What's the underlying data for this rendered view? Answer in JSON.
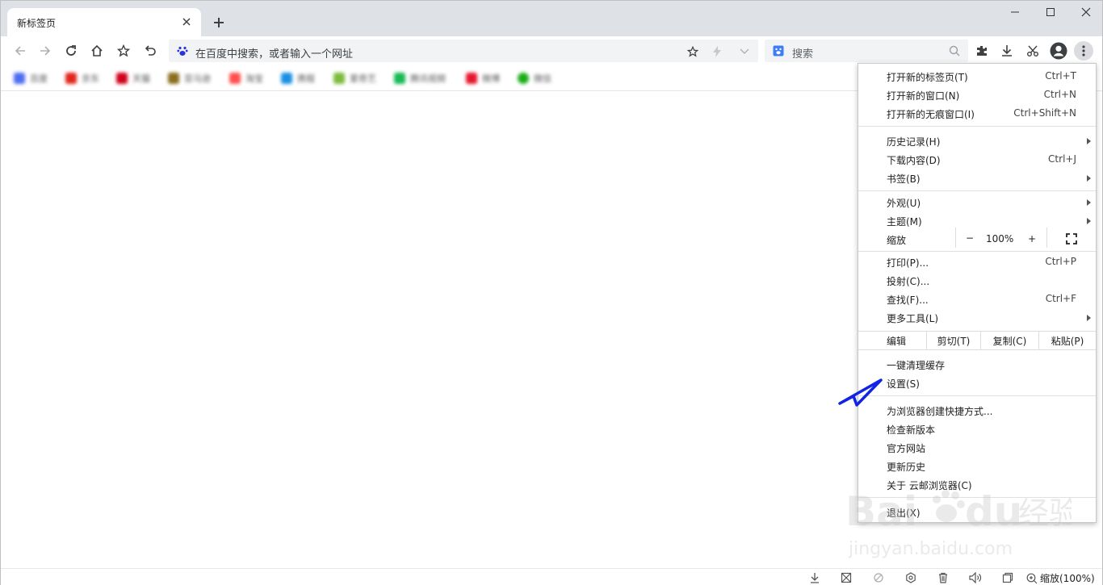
{
  "tab": {
    "title": "新标签页"
  },
  "omnibox": {
    "placeholder": "在百度中搜索，或者输入一个网址"
  },
  "search": {
    "placeholder": "搜索"
  },
  "bookmarks": [
    {
      "label": "百度",
      "color": "#4e6ef2"
    },
    {
      "label": "京东",
      "color": "#e1251b"
    },
    {
      "label": "天猫",
      "color": "#d0021b"
    },
    {
      "label": "亚马逊",
      "color": "#8a6d1e"
    },
    {
      "label": "淘宝",
      "color": "#ff4f4f"
    },
    {
      "label": "携程",
      "color": "#1a8fe3"
    },
    {
      "label": "爱奇艺",
      "color": "#7dbb3c"
    },
    {
      "label": "腾讯视频",
      "color": "#19b955"
    },
    {
      "label": "微博",
      "color": "#e6162d"
    },
    {
      "label": "微信",
      "color": "#1aad19"
    }
  ],
  "menu": {
    "group1": [
      {
        "label": "打开新的标签页(T)",
        "shortcut": "Ctrl+T"
      },
      {
        "label": "打开新的窗口(N)",
        "shortcut": "Ctrl+N"
      },
      {
        "label": "打开新的无痕窗口(I)",
        "shortcut": "Ctrl+Shift+N"
      }
    ],
    "group2": [
      {
        "label": "历史记录(H)",
        "shortcut": ""
      },
      {
        "label": "下载内容(D)",
        "shortcut": "Ctrl+J"
      },
      {
        "label": "书签(B)",
        "shortcut": ""
      }
    ],
    "group3": [
      {
        "label": "外观(U)"
      },
      {
        "label": "主题(M)"
      }
    ],
    "zoom": {
      "label": "缩放",
      "minus": "−",
      "value": "100%",
      "plus": "+"
    },
    "group4": [
      {
        "label": "打印(P)...",
        "shortcut": "Ctrl+P"
      },
      {
        "label": "投射(C)...",
        "shortcut": ""
      },
      {
        "label": "查找(F)...",
        "shortcut": "Ctrl+F"
      },
      {
        "label": "更多工具(L)",
        "shortcut": ""
      }
    ],
    "edit": {
      "label": "编辑",
      "cut": "剪切(T)",
      "copy": "复制(C)",
      "paste": "粘贴(P)"
    },
    "group5": [
      {
        "label": "一键清理缓存"
      },
      {
        "label": "设置(S)"
      }
    ],
    "group6": [
      {
        "label": "为浏览器创建快捷方式..."
      },
      {
        "label": "检查新版本"
      },
      {
        "label": "官方网站"
      },
      {
        "label": "更新历史"
      },
      {
        "label": "关于 云邮浏览器(C)"
      }
    ],
    "exit": {
      "label": "退出(X)"
    }
  },
  "watermark": {
    "text": "Baidu经验",
    "url": "jingyan.baidu.com"
  },
  "statusbar": {
    "zoom": "缩放(100%)"
  },
  "colors": {
    "accent": "#1a73e8",
    "annotation": "#1024e6"
  }
}
